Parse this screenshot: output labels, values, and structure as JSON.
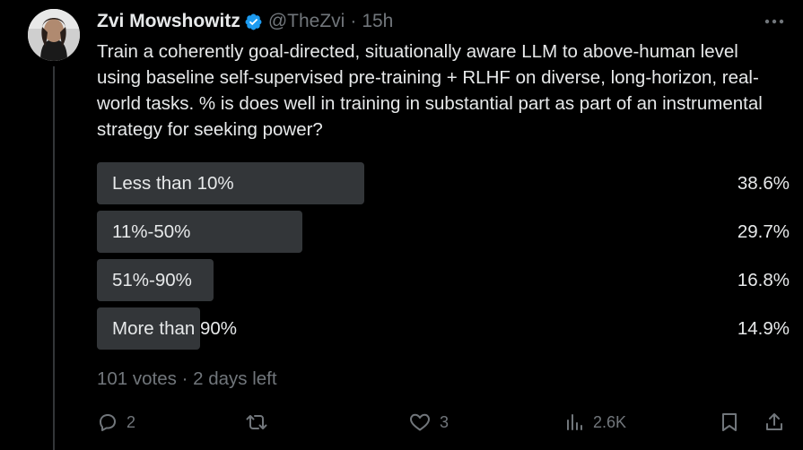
{
  "author": {
    "display_name": "Zvi Mowshowitz",
    "handle": "@TheZvi",
    "separator": "·",
    "time": "15h",
    "avatar_icon": "avatar-photo"
  },
  "tweet": {
    "text": "Train a coherently goal-directed, situationally aware LLM to above-human level using baseline self-supervised pre-training + RLHF on diverse, long-horizon, real-world tasks. % is does well in training in substantial part as part of an instrumental strategy for seeking power?"
  },
  "poll": {
    "options": [
      {
        "label": "Less than 10%",
        "percent": "38.6%",
        "value": 0.386
      },
      {
        "label": "11%-50%",
        "percent": "29.7%",
        "value": 0.297
      },
      {
        "label": "51%-90%",
        "percent": "16.8%",
        "value": 0.168
      },
      {
        "label": "More than 90%",
        "percent": "14.9%",
        "value": 0.149
      }
    ],
    "meta": "101 votes · 2 days left"
  },
  "actions": {
    "reply": {
      "icon": "reply-icon",
      "count": "2"
    },
    "repost": {
      "icon": "repost-icon",
      "count": ""
    },
    "like": {
      "icon": "like-icon",
      "count": "3"
    },
    "views": {
      "icon": "views-icon",
      "count": "2.6K"
    },
    "bookmark": {
      "icon": "bookmark-icon"
    },
    "share": {
      "icon": "share-icon"
    }
  },
  "colors": {
    "background": "#000000",
    "text_primary": "#e7e9ea",
    "text_secondary": "#71767b",
    "poll_bar": "#333639",
    "verified": "#1d9bf0"
  }
}
